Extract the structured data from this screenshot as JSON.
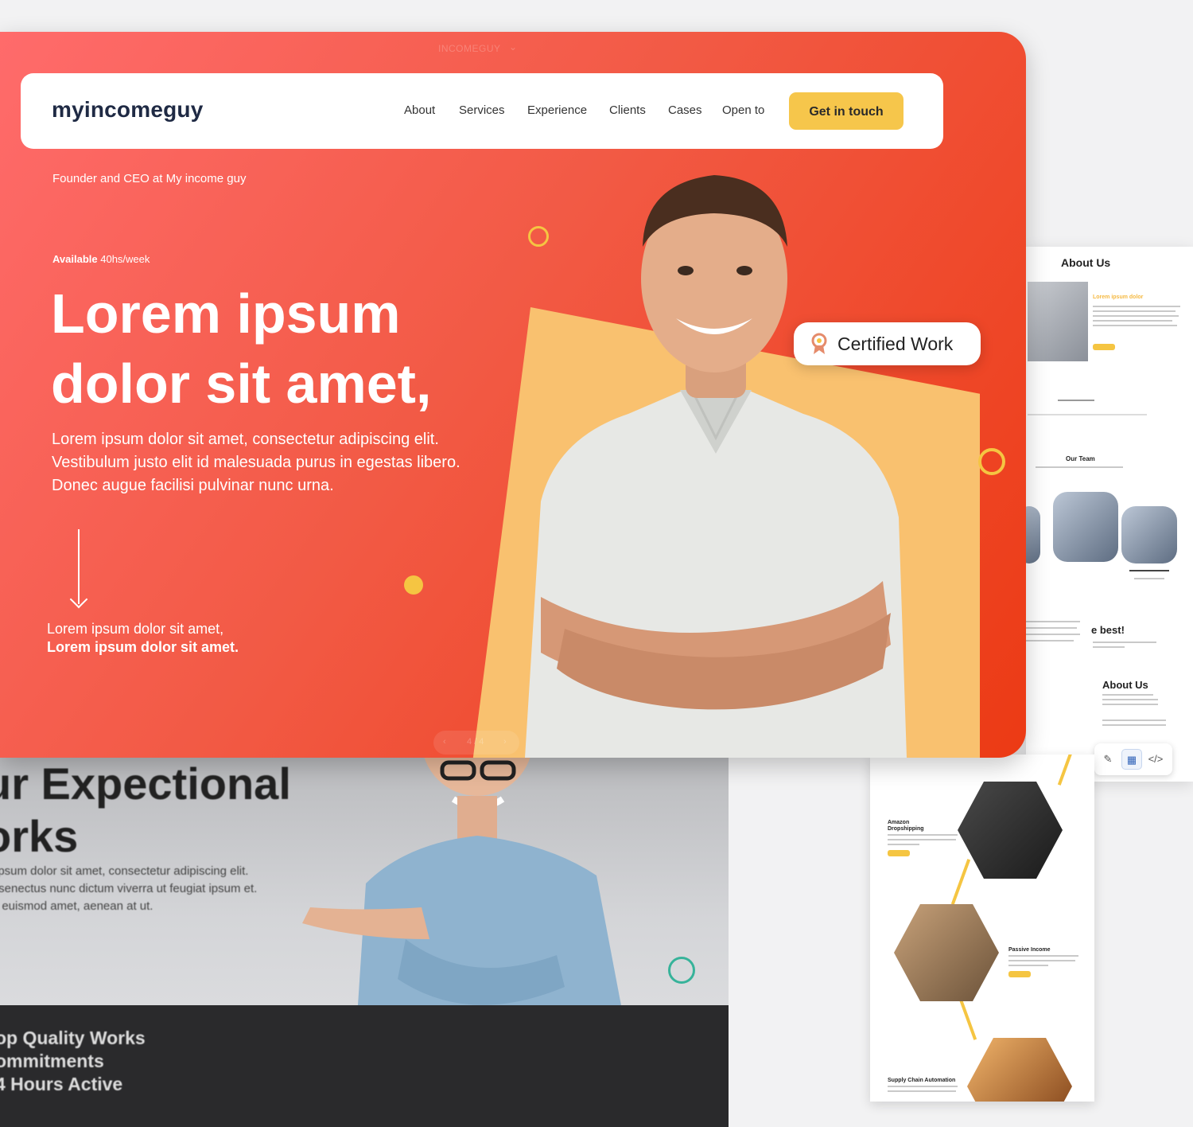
{
  "hero": {
    "window_title": "INCOMEGUY",
    "nav": {
      "logo": "myincomeguy",
      "items": [
        "About",
        "Services",
        "Experience",
        "Clients",
        "Cases",
        "Open to"
      ],
      "cta": "Get in touch"
    },
    "founder_line": "Founder and CEO at My income guy",
    "availability_label": "Available",
    "availability_value": "40hs/week",
    "headline": "Lorem ipsum dolor sit amet,",
    "lead": "Lorem ipsum dolor sit amet, consectetur adipiscing elit. Vestibulum justo elit id malesuada purus in egestas libero. Donec augue facilisi pulvinar nunc urna.",
    "footer_line1": "Lorem ipsum dolor sit amet,",
    "footer_line2": "Lorem ipsum dolor sit amet.",
    "badge": "Certified Work",
    "slider": "4 / 4",
    "colors": {
      "accent": "#f6c64b",
      "gradient_start": "#ff6b6b",
      "gradient_end": "#ec3a14"
    }
  },
  "background_page": {
    "title": "ur Expectional\norks",
    "paragraph": "ipsum dolor sit amet, consectetur adipiscing elit.\n senectus nunc dictum viverra ut feugiat ipsum et.\nt euismod amet, aenean at ut.",
    "list": "op Quality Works\nommitments\n4 Hours Active"
  },
  "side_page": {
    "about_title": "About Us",
    "sub_title": "Lorem ipsum",
    "sub_title_accent": "dolor",
    "team_title": "Our Team",
    "team_member_label": "Lorem ipsum dolor",
    "best_title": "e best!",
    "about_title_2": "About Us"
  },
  "timeline_page": {
    "items": [
      {
        "title": "Amazon\nDropshipping"
      },
      {
        "title": "Passive Income"
      },
      {
        "title": "Supply Chain Automation"
      }
    ]
  },
  "toolbar": {
    "icons": [
      "brush-icon",
      "layout-icon",
      "code-icon"
    ]
  }
}
